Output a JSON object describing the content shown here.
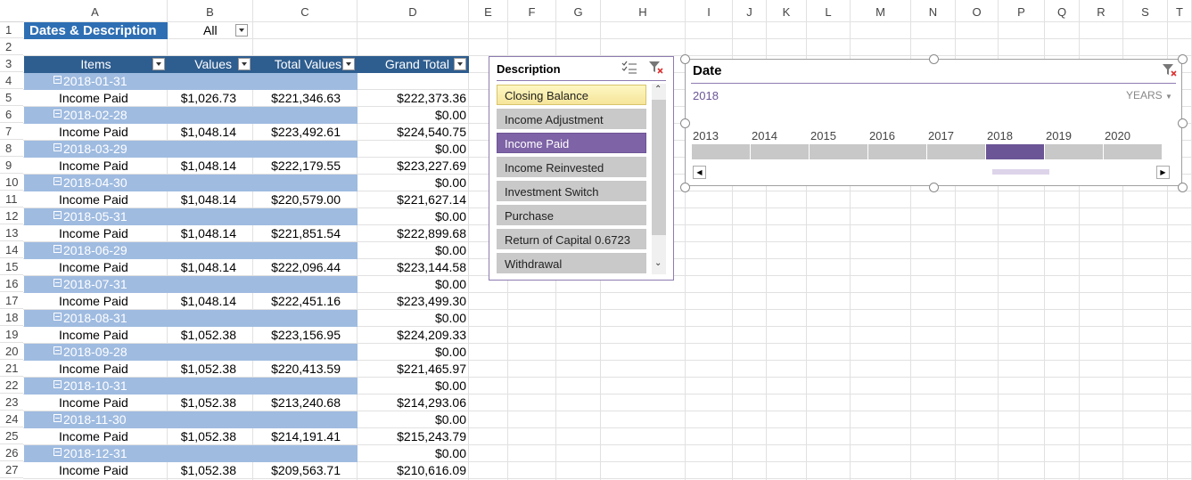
{
  "columns": [
    "A",
    "B",
    "C",
    "D",
    "E",
    "F",
    "G",
    "H",
    "I",
    "J",
    "K",
    "L",
    "M",
    "N",
    "O",
    "P",
    "Q",
    "R",
    "S",
    "T"
  ],
  "rows": [
    "1",
    "2",
    "3",
    "4",
    "5",
    "6",
    "7",
    "8",
    "9",
    "10",
    "11",
    "12",
    "13",
    "14",
    "15",
    "16",
    "17",
    "18",
    "19",
    "20",
    "21",
    "22",
    "23",
    "24",
    "25",
    "26",
    "27"
  ],
  "filter": {
    "label": "Dates & Description",
    "value": "All"
  },
  "pivot_headers": {
    "items": "Items",
    "values": "Values",
    "total_values": "Total Values",
    "grand_total": "Grand Total"
  },
  "pivot_rows": [
    {
      "date": "2018-01-31",
      "item": "Income Paid",
      "value": "$1,026.73",
      "total": "$221,346.63",
      "grand": "$222,373.36",
      "date_total": ""
    },
    {
      "date": "2018-02-28",
      "item": "Income Paid",
      "value": "$1,048.14",
      "total": "$223,492.61",
      "grand": "$224,540.75",
      "date_total": "$0.00"
    },
    {
      "date": "2018-03-29",
      "item": "Income Paid",
      "value": "$1,048.14",
      "total": "$222,179.55",
      "grand": "$223,227.69",
      "date_total": "$0.00"
    },
    {
      "date": "2018-04-30",
      "item": "Income Paid",
      "value": "$1,048.14",
      "total": "$220,579.00",
      "grand": "$221,627.14",
      "date_total": "$0.00"
    },
    {
      "date": "2018-05-31",
      "item": "Income Paid",
      "value": "$1,048.14",
      "total": "$221,851.54",
      "grand": "$222,899.68",
      "date_total": "$0.00"
    },
    {
      "date": "2018-06-29",
      "item": "Income Paid",
      "value": "$1,048.14",
      "total": "$222,096.44",
      "grand": "$223,144.58",
      "date_total": "$0.00"
    },
    {
      "date": "2018-07-31",
      "item": "Income Paid",
      "value": "$1,048.14",
      "total": "$222,451.16",
      "grand": "$223,499.30",
      "date_total": "$0.00"
    },
    {
      "date": "2018-08-31",
      "item": "Income Paid",
      "value": "$1,052.38",
      "total": "$223,156.95",
      "grand": "$224,209.33",
      "date_total": "$0.00"
    },
    {
      "date": "2018-09-28",
      "item": "Income Paid",
      "value": "$1,052.38",
      "total": "$220,413.59",
      "grand": "$221,465.97",
      "date_total": "$0.00"
    },
    {
      "date": "2018-10-31",
      "item": "Income Paid",
      "value": "$1,052.38",
      "total": "$213,240.68",
      "grand": "$214,293.06",
      "date_total": "$0.00"
    },
    {
      "date": "2018-11-30",
      "item": "Income Paid",
      "value": "$1,052.38",
      "total": "$214,191.41",
      "grand": "$215,243.79",
      "date_total": "$0.00"
    },
    {
      "date": "2018-12-31",
      "item": "Income Paid",
      "value": "$1,052.38",
      "total": "$209,563.71",
      "grand": "$210,616.09",
      "date_total": "$0.00"
    }
  ],
  "slicer": {
    "title": "Description",
    "items": [
      {
        "label": "Closing Balance",
        "state": "hover"
      },
      {
        "label": "Income Adjustment",
        "state": "off"
      },
      {
        "label": "Income Paid",
        "state": "selected"
      },
      {
        "label": "Income Reinvested",
        "state": "off"
      },
      {
        "label": "Investment Switch",
        "state": "off"
      },
      {
        "label": "Purchase",
        "state": "off"
      },
      {
        "label": "Return of Capital 0.6723",
        "state": "off"
      },
      {
        "label": "Withdrawal",
        "state": "off"
      }
    ]
  },
  "timeline": {
    "title": "Date",
    "selection": "2018",
    "level": "YEARS",
    "years": [
      "2013",
      "2014",
      "2015",
      "2016",
      "2017",
      "2018",
      "2019",
      "2020"
    ],
    "selected_year": "2018"
  },
  "colors": {
    "header_blue": "#2e5d8f",
    "section_blue": "#9fbbe0",
    "slicer_purple": "#7e63a6"
  }
}
